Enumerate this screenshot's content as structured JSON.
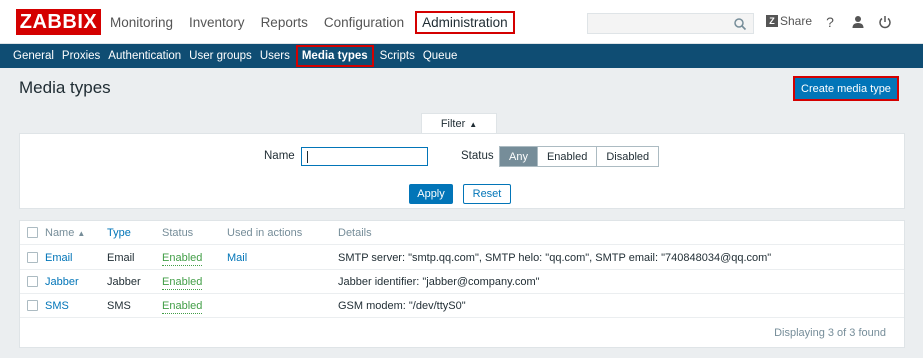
{
  "header": {
    "logo": "ZABBIX",
    "nav": [
      "Monitoring",
      "Inventory",
      "Reports",
      "Configuration",
      "Administration"
    ],
    "active_nav": "Administration",
    "search_value": "",
    "share_label": "Share",
    "share_badge": "Z",
    "help_glyph": "?",
    "icons": [
      "search-icon",
      "share-icon",
      "help-icon",
      "user-icon",
      "logout-icon"
    ]
  },
  "subnav": {
    "items": [
      "General",
      "Proxies",
      "Authentication",
      "User groups",
      "Users",
      "Media types",
      "Scripts",
      "Queue"
    ],
    "active": "Media types"
  },
  "page": {
    "title": "Media types",
    "create_button": "Create media type"
  },
  "filter": {
    "tab_label": "Filter",
    "name_label": "Name",
    "name_value": "",
    "status_label": "Status",
    "status_options": [
      "Any",
      "Enabled",
      "Disabled"
    ],
    "status_selected": "Any",
    "apply_label": "Apply",
    "reset_label": "Reset"
  },
  "table": {
    "columns": [
      "Name",
      "Type",
      "Status",
      "Used in actions",
      "Details"
    ],
    "sorted_column": "Name",
    "rows": [
      {
        "name": "Email",
        "type": "Email",
        "status": "Enabled",
        "used": "Mail",
        "details": "SMTP server: \"smtp.qq.com\", SMTP helo: \"qq.com\", SMTP email: \"740848034@qq.com\""
      },
      {
        "name": "Jabber",
        "type": "Jabber",
        "status": "Enabled",
        "used": "",
        "details": "Jabber identifier: \"jabber@company.com\""
      },
      {
        "name": "SMS",
        "type": "SMS",
        "status": "Enabled",
        "used": "",
        "details": "GSM modem: \"/dev/ttyS0\""
      }
    ],
    "footer": "Displaying 3 of 3 found"
  },
  "colors": {
    "brand": "#d40000",
    "subnav_bg": "#0f4d73",
    "primary": "#0275b8",
    "enabled": "#429e47",
    "highlight": "#d40000"
  }
}
